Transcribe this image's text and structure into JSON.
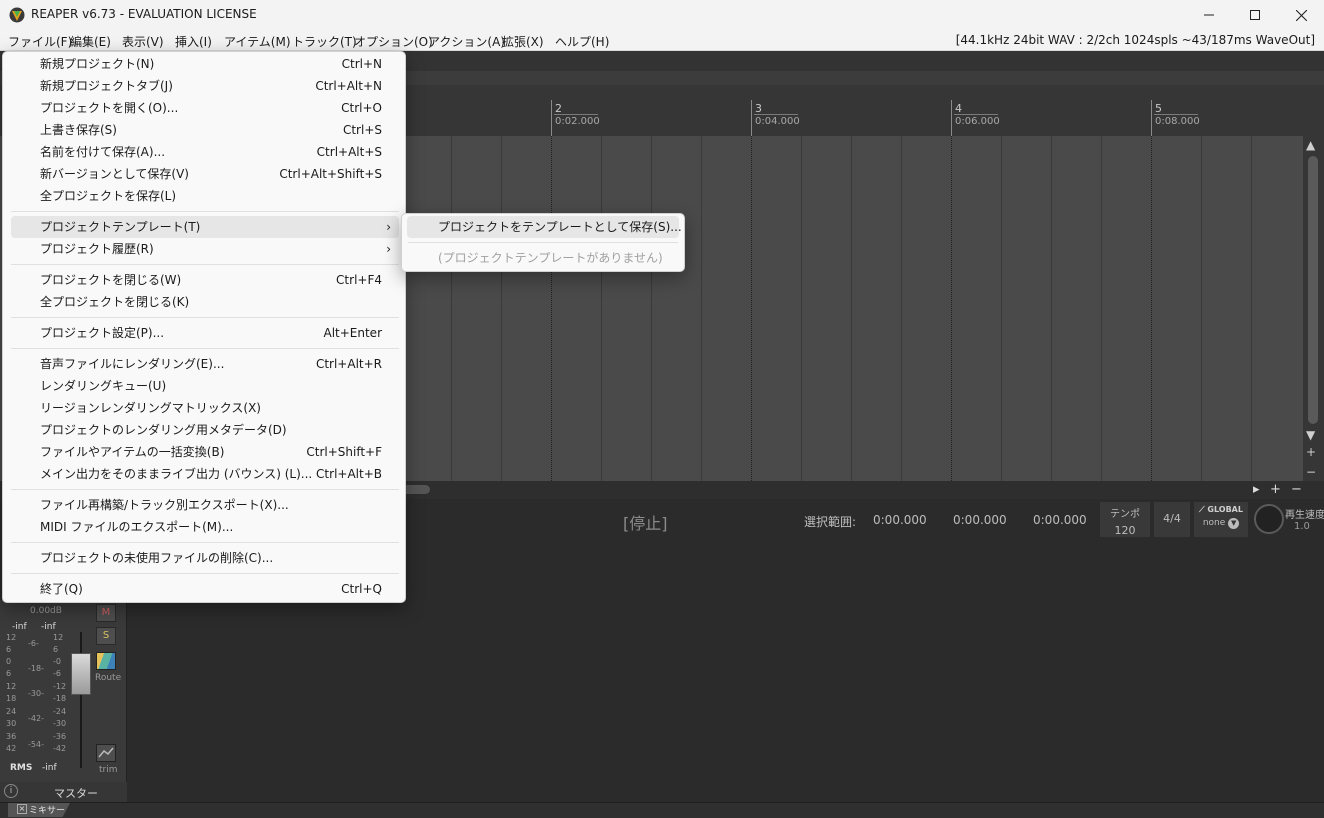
{
  "window": {
    "title": "REAPER v6.73 - EVALUATION LICENSE"
  },
  "menubar": {
    "items": [
      "ファイル(F)",
      "編集(E)",
      "表示(V)",
      "挿入(I)",
      "アイテム(M)",
      "トラック(T)",
      "オプション(O)",
      "アクション(A)",
      "拡張(X)",
      "ヘルプ(H)"
    ],
    "status": "[44.1kHz 24bit WAV : 2/2ch 1024spls ~43/187ms WaveOut]"
  },
  "ruler": {
    "marks": [
      {
        "num": "2",
        "time": "0:02.000"
      },
      {
        "num": "3",
        "time": "0:04.000"
      },
      {
        "num": "4",
        "time": "0:06.000"
      },
      {
        "num": "5",
        "time": "0:08.000"
      }
    ]
  },
  "transport": {
    "state": "[停止]",
    "selection_label": "選択範囲:",
    "selection_values": [
      "0:00.000",
      "0:00.000",
      "0:00.000"
    ],
    "tempo_label": "テンポ",
    "tempo_value": "120",
    "time_signature": "4/4",
    "global_label": "GLOBAL",
    "global_value": "none",
    "rate_label": "再生速度",
    "rate_value": "1.0"
  },
  "master": {
    "db": "0.00dB",
    "peak_left": "-inf",
    "peak_right": "-inf",
    "mute": "M",
    "solo": "S",
    "route": "Route",
    "trim": "trim",
    "rms_label": "RMS",
    "rms_value": "-inf",
    "name": "マスター",
    "scale_left": [
      "12",
      "6",
      "0",
      "6",
      "12",
      "18",
      "24",
      "30",
      "36",
      "42"
    ],
    "scale_mid": [
      "-6-",
      "-18-",
      "-30-",
      "-42-",
      "-54-"
    ],
    "scale_right": [
      "12",
      "6",
      "-0",
      "-6",
      "-12",
      "-18",
      "-24",
      "-30",
      "-36",
      "-42"
    ]
  },
  "bottom": {
    "mixer_tab": "ミキサー"
  },
  "file_menu": {
    "items": [
      {
        "label": "新規プロジェクト(N)",
        "shortcut": "Ctrl+N"
      },
      {
        "label": "新規プロジェクトタブ(J)",
        "shortcut": "Ctrl+Alt+N"
      },
      {
        "label": "プロジェクトを開く(O)...",
        "shortcut": "Ctrl+O"
      },
      {
        "label": "上書き保存(S)",
        "shortcut": "Ctrl+S"
      },
      {
        "label": "名前を付けて保存(A)...",
        "shortcut": "Ctrl+Alt+S"
      },
      {
        "label": "新バージョンとして保存(V)",
        "shortcut": "Ctrl+Alt+Shift+S"
      },
      {
        "label": "全プロジェクトを保存(L)",
        "shortcut": ""
      },
      {
        "label": "プロジェクトテンプレート(T)",
        "shortcut": ""
      },
      {
        "label": "プロジェクト履歴(R)",
        "shortcut": ""
      },
      {
        "label": "プロジェクトを閉じる(W)",
        "shortcut": "Ctrl+F4"
      },
      {
        "label": "全プロジェクトを閉じる(K)",
        "shortcut": ""
      },
      {
        "label": "プロジェクト設定(P)...",
        "shortcut": "Alt+Enter"
      },
      {
        "label": "音声ファイルにレンダリング(E)...",
        "shortcut": "Ctrl+Alt+R"
      },
      {
        "label": "レンダリングキュー(U)",
        "shortcut": ""
      },
      {
        "label": "リージョンレンダリングマトリックス(X)",
        "shortcut": ""
      },
      {
        "label": "プロジェクトのレンダリング用メタデータ(D)",
        "shortcut": ""
      },
      {
        "label": "ファイルやアイテムの一括変換(B)",
        "shortcut": "Ctrl+Shift+F"
      },
      {
        "label": "メイン出力をそのままライブ出力 (バウンス) (L)...",
        "shortcut": "Ctrl+Alt+B"
      },
      {
        "label": "ファイル再構築/トラック別エクスポート(X)...",
        "shortcut": ""
      },
      {
        "label": "MIDI ファイルのエクスポート(M)...",
        "shortcut": ""
      },
      {
        "label": "プロジェクトの未使用ファイルの削除(C)...",
        "shortcut": ""
      },
      {
        "label": "終了(Q)",
        "shortcut": "Ctrl+Q"
      }
    ]
  },
  "template_submenu": {
    "items": [
      {
        "label": "プロジェクトをテンプレートとして保存(S)..."
      },
      {
        "label": "(プロジェクトテンプレートがありません)"
      }
    ]
  }
}
